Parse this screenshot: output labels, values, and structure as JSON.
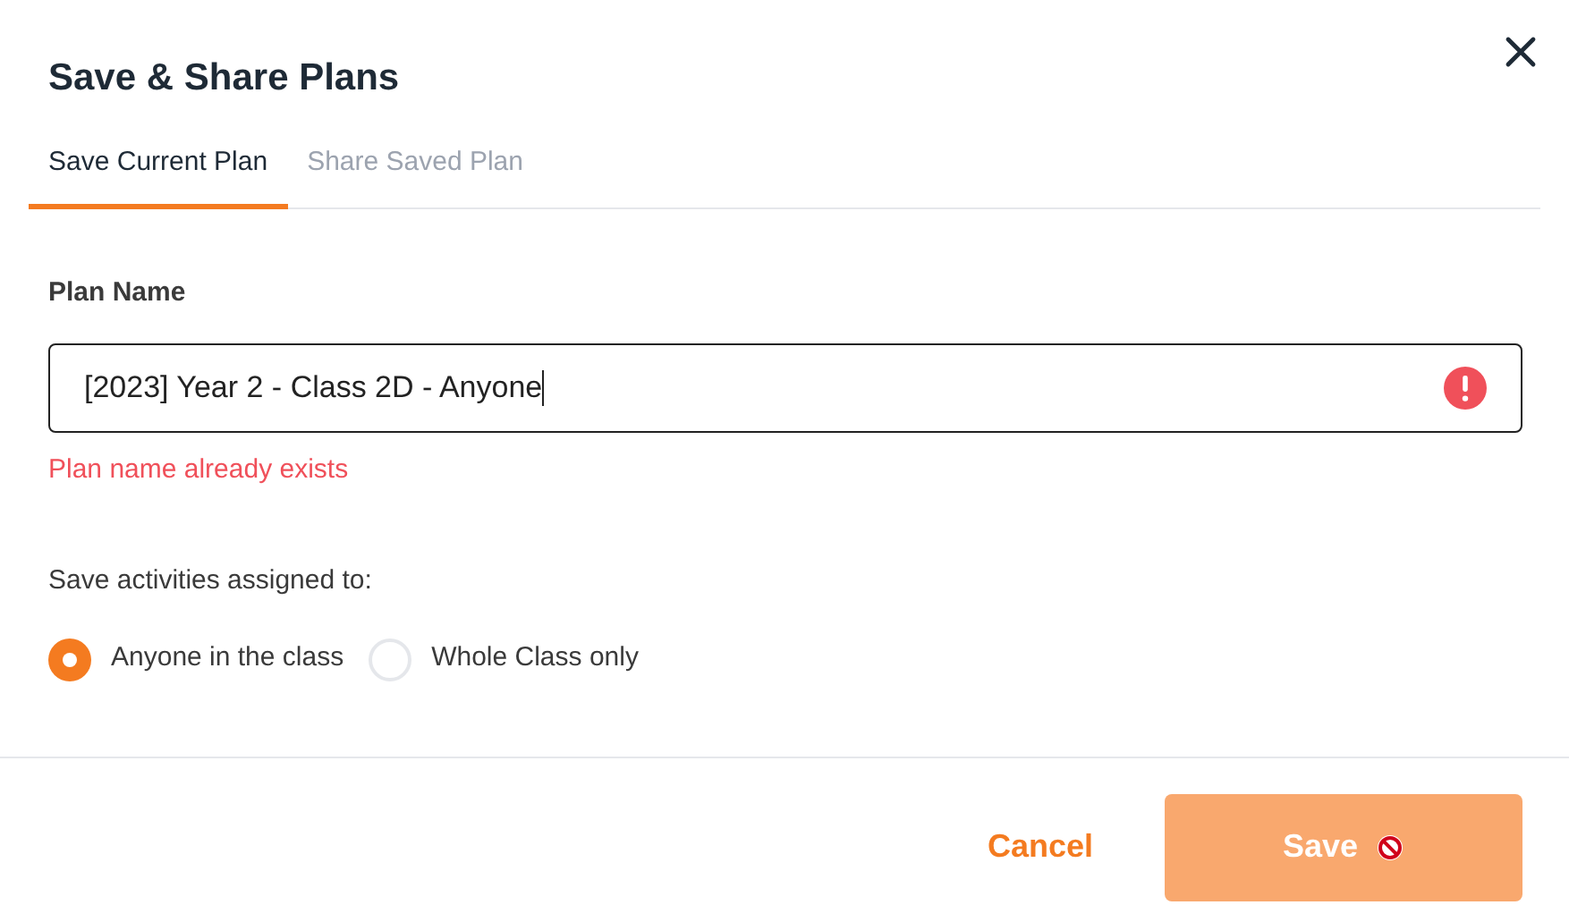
{
  "dialog": {
    "title": "Save & Share Plans"
  },
  "tabs": [
    {
      "label": "Save Current Plan",
      "selected": true
    },
    {
      "label": "Share Saved Plan",
      "selected": false
    }
  ],
  "plan_name": {
    "label": "Plan Name",
    "value": "[2023] Year 2 - Class 2D - Anyone",
    "invalid": true,
    "error": "Plan name already exists"
  },
  "assignment": {
    "label": "Save activities assigned to:",
    "options": [
      {
        "label": "Anyone in the class",
        "selected": true
      },
      {
        "label": "Whole Class only",
        "selected": false
      }
    ]
  },
  "footer": {
    "cancel": "Cancel",
    "save": {
      "label": "Save",
      "disabled": true
    }
  }
}
